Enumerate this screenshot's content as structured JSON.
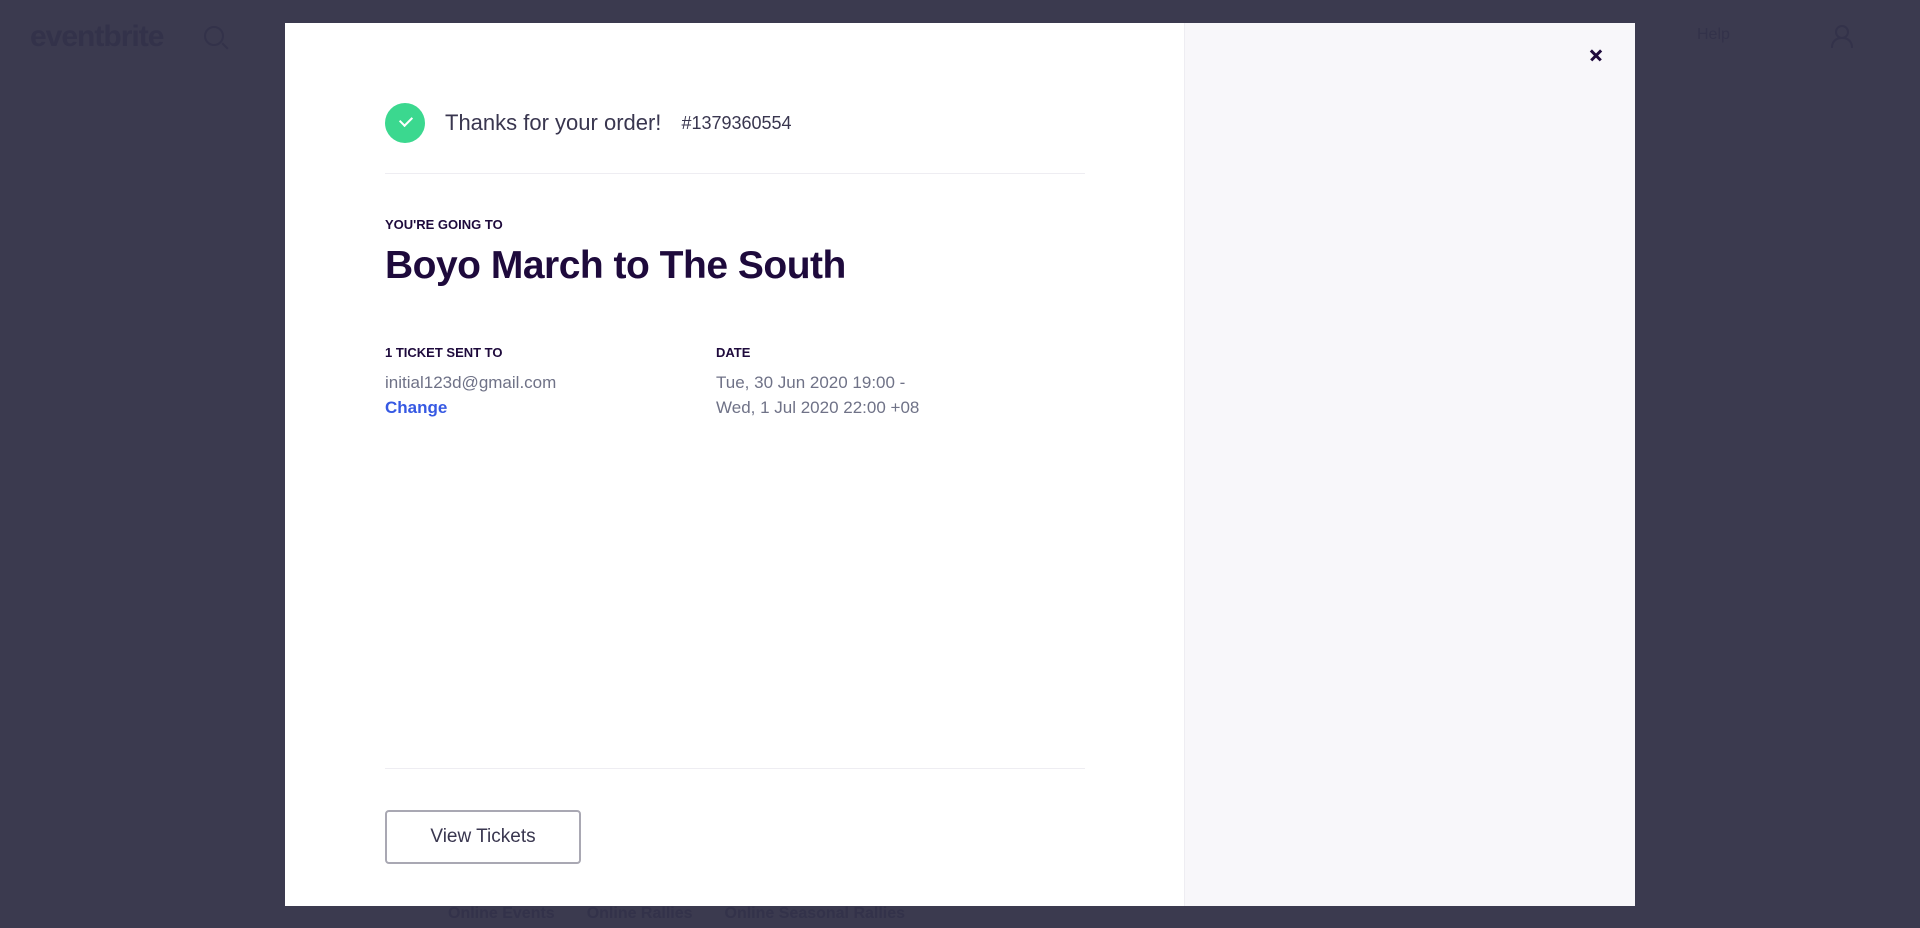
{
  "background": {
    "logo": "eventbrite",
    "nav_right": "",
    "help": "Help",
    "categories": [
      "Online Events",
      "Online Rallies",
      "Online Seasonal Rallies"
    ]
  },
  "modal": {
    "thanks": "Thanks for your order!",
    "order_number": "#1379360554",
    "going_label": "YOU'RE GOING TO",
    "event_title": "Boyo March to The South",
    "tickets": {
      "label": "1 TICKET SENT TO",
      "email": "initial123d@gmail.com",
      "change": "Change"
    },
    "date": {
      "label": "DATE",
      "line1": "Tue, 30 Jun 2020 19:00 -",
      "line2": "Wed, 1 Jul 2020 22:00 +08"
    },
    "view_tickets": "View Tickets"
  },
  "colors": {
    "overlay": "#3b3a4f",
    "success": "#3bd88f",
    "title": "#1e0a3c",
    "link": "#3659e3"
  }
}
